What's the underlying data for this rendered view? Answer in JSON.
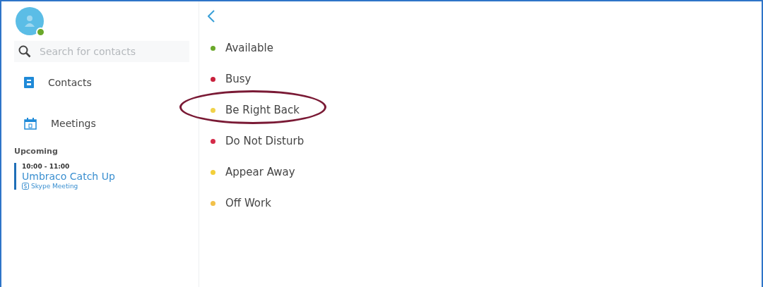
{
  "sidebar": {
    "search": {
      "placeholder": "Search for contacts"
    },
    "nav": [
      {
        "label": "Contacts",
        "kind": "contacts"
      },
      {
        "label": "Meetings",
        "kind": "meetings"
      }
    ],
    "upcoming": {
      "heading": "Upcoming",
      "events": [
        {
          "time": "10:00 - 11:00",
          "title": "Umbraco Catch Up",
          "source": "Skype Meeting"
        }
      ]
    }
  },
  "statuses": [
    {
      "label": "Available",
      "color": "#6aa82a",
      "highlighted": false
    },
    {
      "label": "Busy",
      "color": "#c8203c",
      "highlighted": false
    },
    {
      "label": "Be Right Back",
      "color": "#f0d24a",
      "highlighted": true
    },
    {
      "label": "Do Not Disturb",
      "color": "#d42a48",
      "highlighted": false
    },
    {
      "label": "Appear Away",
      "color": "#f3cf3a",
      "highlighted": false
    },
    {
      "label": "Off Work",
      "color": "#f2c14a",
      "highlighted": false
    }
  ]
}
